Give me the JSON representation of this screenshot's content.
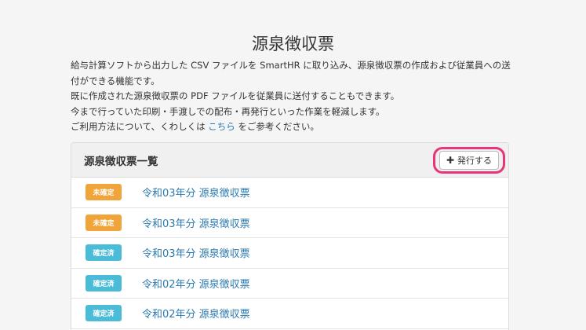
{
  "page": {
    "title": "源泉徴収票",
    "description": {
      "line1": "給与計算ソフトから出力した CSV ファイルを SmartHR に取り込み、源泉徴収票の作成および従業員への送付ができる機能です。",
      "line2": "既に作成された源泉徴収票の PDF ファイルを従業員に送付することもできます。",
      "line3": "今まで行っていた印刷・手渡しでの配布・再発行といった作業を軽減します。",
      "line4_pre": "ご利用方法について、くわしくは ",
      "line4_link": "こちら",
      "line4_post": " をご参考ください。"
    }
  },
  "panel": {
    "title": "源泉徴収票一覧",
    "issue_button": "発行する",
    "issue_icon": "plus-icon",
    "highlight_color": "#e8357a"
  },
  "colors": {
    "unconfirmed": "#f0a43a",
    "confirmed": "#4bbcd8",
    "link": "#2a7ab0"
  },
  "rows": [
    {
      "status": "未確定",
      "status_type": "unconfirmed",
      "label": "令和03年分 源泉徴収票"
    },
    {
      "status": "未確定",
      "status_type": "unconfirmed",
      "label": "令和03年分 源泉徴収票"
    },
    {
      "status": "確定済",
      "status_type": "confirmed",
      "label": "令和03年分 源泉徴収票"
    },
    {
      "status": "確定済",
      "status_type": "confirmed",
      "label": "令和02年分 源泉徴収票"
    },
    {
      "status": "確定済",
      "status_type": "confirmed",
      "label": "令和02年分 源泉徴収票"
    }
  ]
}
